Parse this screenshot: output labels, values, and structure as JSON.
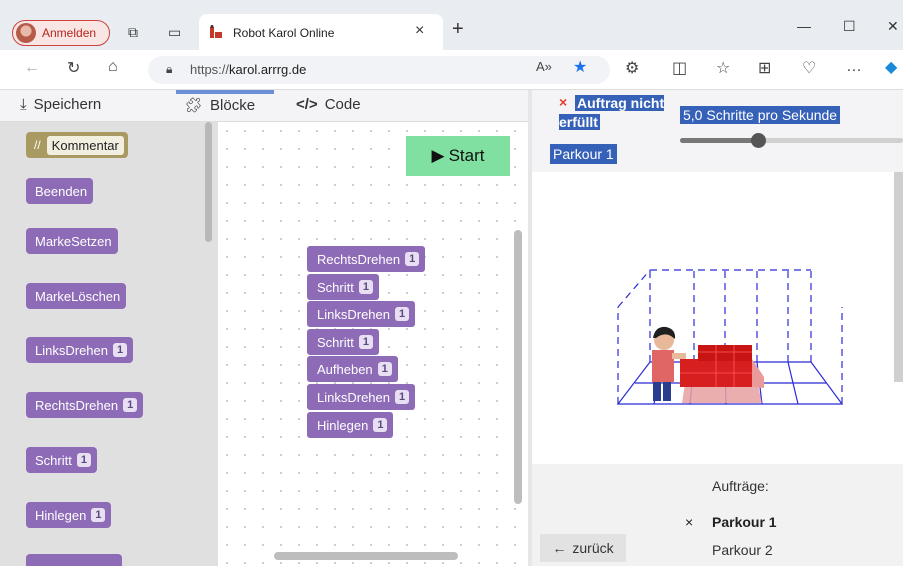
{
  "browser": {
    "profile_label": "Anmelden",
    "tab_title": "Robot Karol Online",
    "url_prefix": "https://",
    "url_host": "karol.arrrg.de",
    "tab_close": "×",
    "new_tab": "+"
  },
  "editor": {
    "save_label": "Speichern",
    "blocks_tab_label": "Blöcke",
    "code_tab_label": "Code"
  },
  "toolbox": {
    "comment_prefix": "//",
    "comment_label": "Kommentar",
    "blocks": [
      {
        "label": "Beenden",
        "number": ""
      },
      {
        "label": "MarkeSetzen",
        "number": ""
      },
      {
        "label": "MarkeLöschen",
        "number": ""
      },
      {
        "label": "LinksDrehen",
        "number": "1"
      },
      {
        "label": "RechtsDrehen",
        "number": "1"
      },
      {
        "label": "Schritt",
        "number": "1"
      },
      {
        "label": "Hinlegen",
        "number": "1"
      }
    ]
  },
  "workspace": {
    "start_label": "Start",
    "program": [
      {
        "label": "RechtsDrehen",
        "number": "1"
      },
      {
        "label": "Schritt",
        "number": "1"
      },
      {
        "label": "LinksDrehen",
        "number": "1"
      },
      {
        "label": "Schritt",
        "number": "1"
      },
      {
        "label": "Aufheben",
        "number": "1"
      },
      {
        "label": "LinksDrehen",
        "number": "1"
      },
      {
        "label": "Hinlegen",
        "number": "1"
      }
    ]
  },
  "status": {
    "icon": "×",
    "text": "Auftrag nicht erfüllt",
    "speed_label": "5,0 Schritte pro Sekunde",
    "speed_fraction": 0.35,
    "world_label": "Parkour 1"
  },
  "tasks": {
    "title": "Aufträge:",
    "items": [
      {
        "label": "Parkour 1",
        "marker": "×"
      },
      {
        "label": "Parkour 2",
        "marker": ""
      }
    ],
    "back_label": "zurück"
  },
  "colors": {
    "accent": "#3661b8",
    "block": "#8d6bb6",
    "start": "#7fe0a1",
    "error": "#e23b2f"
  }
}
